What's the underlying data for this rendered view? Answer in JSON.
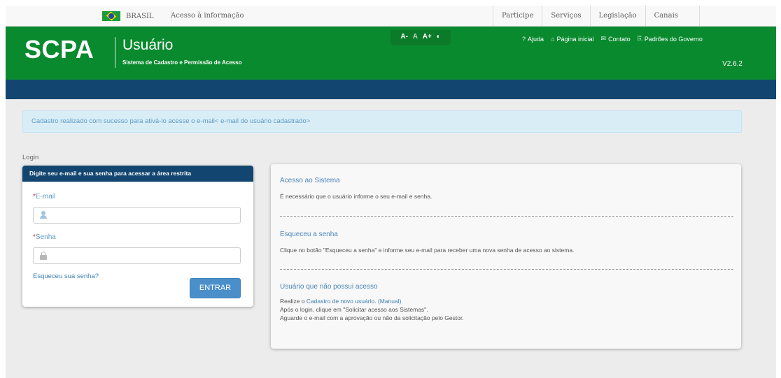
{
  "govbar": {
    "country": "BRASIL",
    "access_info": "Acesso à informação",
    "links": [
      "Participe",
      "Serviços",
      "Legislação",
      "Canais"
    ]
  },
  "header": {
    "logo": "SCPA",
    "title": "Usuário",
    "subtitle": "Sistema de Cadastro e Permissão de Acesso",
    "accessibility": [
      "A-",
      "A",
      "A+",
      "◐"
    ],
    "links": [
      {
        "icon": "help-icon",
        "glyph": "?",
        "label": "Ajuda"
      },
      {
        "icon": "home-icon",
        "glyph": "⌂",
        "label": "Página inicial"
      },
      {
        "icon": "mail-icon",
        "glyph": "✉",
        "label": "Contato"
      },
      {
        "icon": "document-icon",
        "glyph": "⎘",
        "label": "Padrões do Governo"
      }
    ],
    "version": "V2.6.2"
  },
  "alert": {
    "text": "Cadastro realizado com sucesso para ativá-lo acesse o e-mail< e-mail do usuário cadastrado>"
  },
  "login": {
    "section_label": "Login",
    "panel_title": "Digite seu e-mail e sua senha para acessar a área restrita",
    "required_mark": "*",
    "email_label": "E-mail",
    "email_value": "",
    "password_label": "Senha",
    "password_value": "",
    "forgot_link": "Esqueceu sua senha?",
    "submit_label": "ENTRAR"
  },
  "info": {
    "access_title": "Acesso ao Sistema",
    "access_text": "É necessário que o usuário informe o seu e-mail e senha.",
    "forgot_title": "Esqueceu a senha",
    "forgot_text": "Clique no botão \"Esqueceu a senha\" e informe seu e-mail para receber uma nova senha de acesso ao sistema.",
    "noaccess_title": "Usuário que não possui acesso",
    "line1_prefix": "Realize o ",
    "line1_link": "Cadastro de novo usuário",
    "line1_sep": ". ",
    "line1_manual": "(Manual)",
    "line2": "Após o login, clique em \"Solicitar acesso aos Sistemas\".",
    "line3": "Aguarde o e-mail com a aprovação ou não da solicitação pelo Gestor."
  },
  "colors": {
    "header_green": "#098a2e",
    "navbar_blue": "#12456f",
    "alert_bg": "#d9edf7",
    "button_blue": "#4a8fca",
    "link_blue": "#3d7fb5"
  }
}
